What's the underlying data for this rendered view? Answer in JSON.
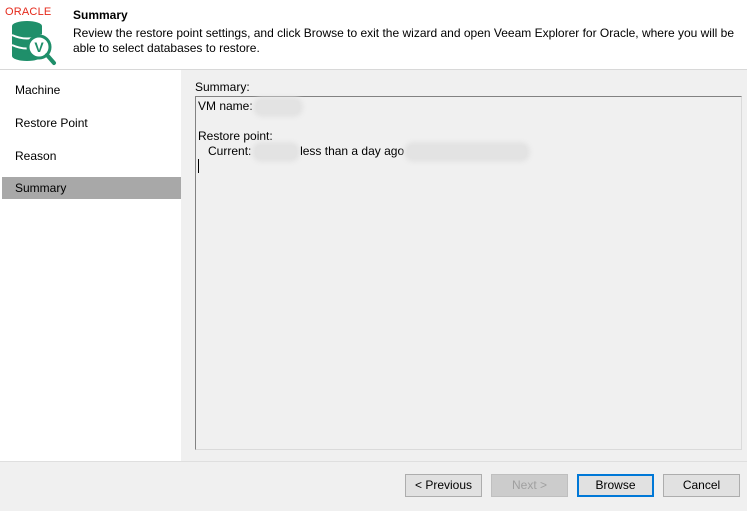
{
  "header": {
    "logo_text": "ORACLE",
    "title": "Summary",
    "description": "Review the restore point settings, and click Browse to exit the wizard and open Veeam Explorer for Oracle, where you will be able to select databases to restore."
  },
  "sidebar": {
    "items": [
      {
        "label": "Machine"
      },
      {
        "label": "Restore Point"
      },
      {
        "label": "Reason"
      },
      {
        "label": "Summary"
      }
    ]
  },
  "summary": {
    "label": "Summary:",
    "vm_name_label": "VM name:",
    "restore_point_label": "Restore point:",
    "current_label": "Current:",
    "current_age": "less than a day ago"
  },
  "buttons": {
    "previous": "< Previous",
    "next": "Next >",
    "browse": "Browse",
    "cancel": "Cancel"
  },
  "colors": {
    "oracle_red": "#e5291b",
    "icon_green": "#1f8f6a",
    "selected_step": "#a8a8a8",
    "focus_border": "#0078d7"
  }
}
